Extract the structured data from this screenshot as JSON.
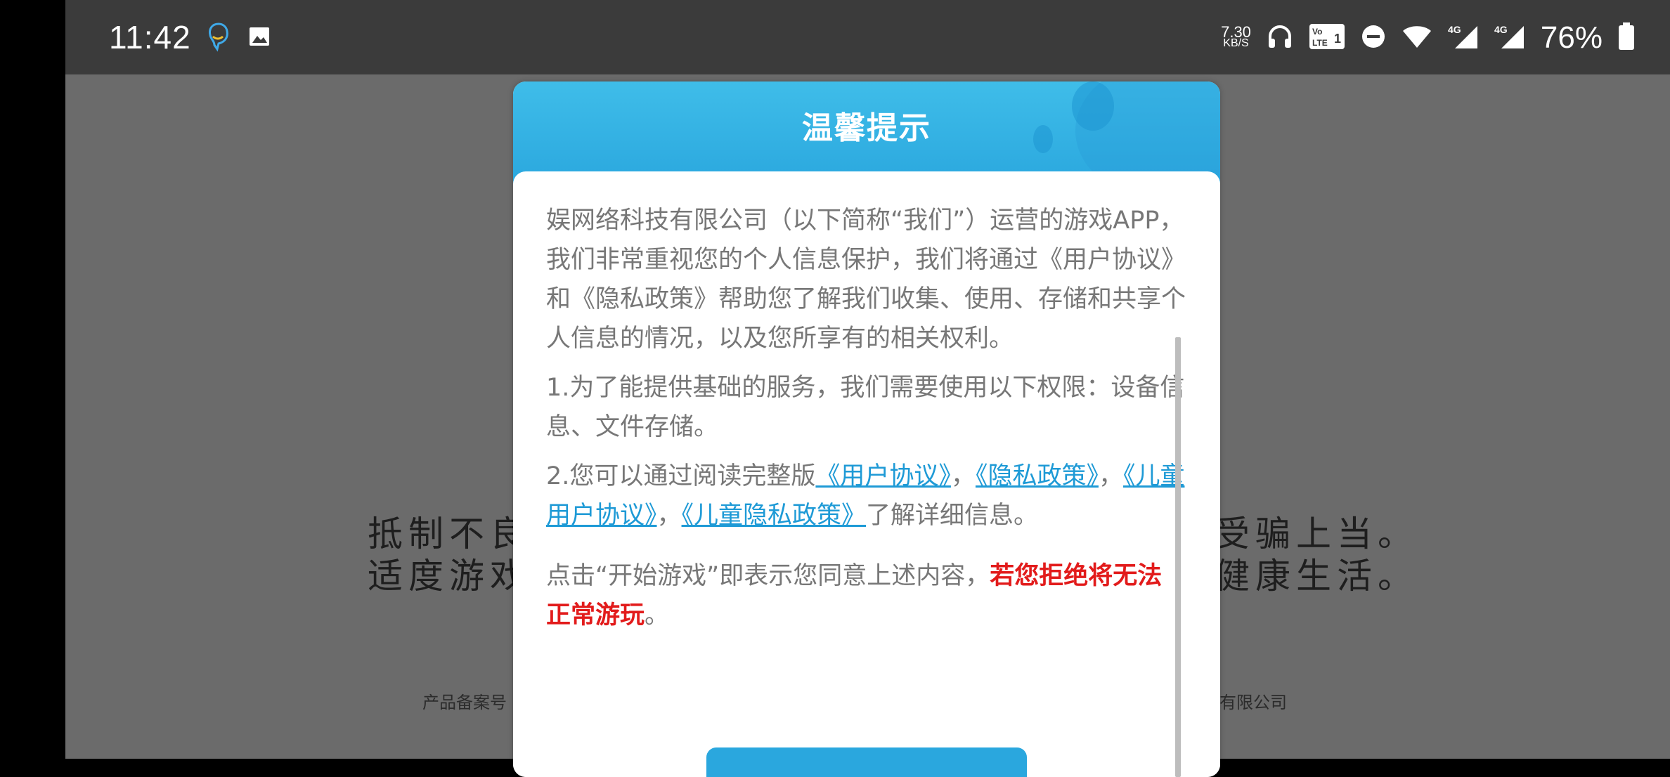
{
  "status_bar": {
    "time": "11:42",
    "net_speed_value": "7.30",
    "net_speed_unit": "KB/S",
    "battery": "76%",
    "icons": [
      "chat-notification-icon",
      "image-notification-icon",
      "headphones-icon",
      "volte-icon",
      "dnd-icon",
      "wifi-icon",
      "signal-4g-icon",
      "signal-4g-icon",
      "battery-icon"
    ]
  },
  "background": {
    "line1_left": "抵制不良",
    "line1_right": "受骗上当。",
    "line2_left": "适度游戏",
    "line2_right": "健康生活。",
    "footer_left": "产品备案号",
    "footer_right": "有限公司"
  },
  "dialog": {
    "title": "温馨提示",
    "para1": "娱网络科技有限公司（以下简称“我们”）运营的游戏APP，我们非常重视您的个人信息保护，我们将通过《用户协议》和《隐私政策》帮助您了解我们收集、使用、存储和共享个人信息的情况，以及您所享有的相关权利。",
    "para2": "1.为了能提供基础的服务，我们需要使用以下权限：设备信息、文件存储。",
    "para3_prefix": "2.您可以通过阅读完整版",
    "link_user_agreement": "《用户协议》",
    "link_privacy": "《隐私政策》",
    "link_child_agreement": "《儿童用户协议》",
    "link_child_privacy": "《儿童隐私政策》",
    "sep": "，",
    "para3_suffix": "了解详细信息。",
    "para4_prefix": "点击“开始游戏”即表示您同意上述内容，",
    "para4_warning": "若您拒绝将无法正常游玩",
    "para4_end": "。"
  },
  "colors": {
    "header": "#2aa7de",
    "link": "#1e9ad6",
    "warning": "#e21b1b",
    "body_text": "#777777"
  }
}
